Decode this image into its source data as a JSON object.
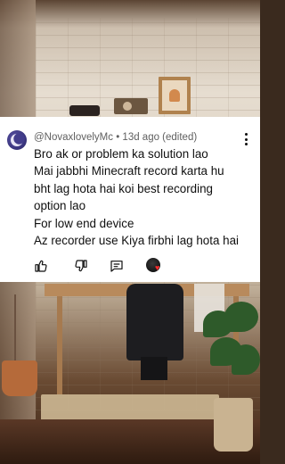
{
  "comment": {
    "author": "@NovaxlovelyMc",
    "separator": "•",
    "time": "13d ago (edited)",
    "meta_text": "@NovaxlovelyMc • 13d ago (edited)",
    "lines": [
      "Bro ak or problem ka solution lao",
      "Mai jabbhi Minecraft record karta hu",
      "bht lag hota hai koi best recording",
      "option lao",
      "For low end device",
      "Az recorder use Kiya firbhi lag hota hai"
    ],
    "heart_glyph": "♥"
  },
  "icons": {
    "avatar": "crescent-moon-avatar",
    "more": "more-vertical-icon",
    "like": "thumbs-up-icon",
    "dislike": "thumbs-down-icon",
    "reply": "reply-icon",
    "creator_heart": "creator-heart-badge"
  },
  "colors": {
    "card_bg": "#ffffff",
    "text": "#0f0f0f",
    "meta_text": "#606060",
    "heart": "#ff2d2d"
  }
}
